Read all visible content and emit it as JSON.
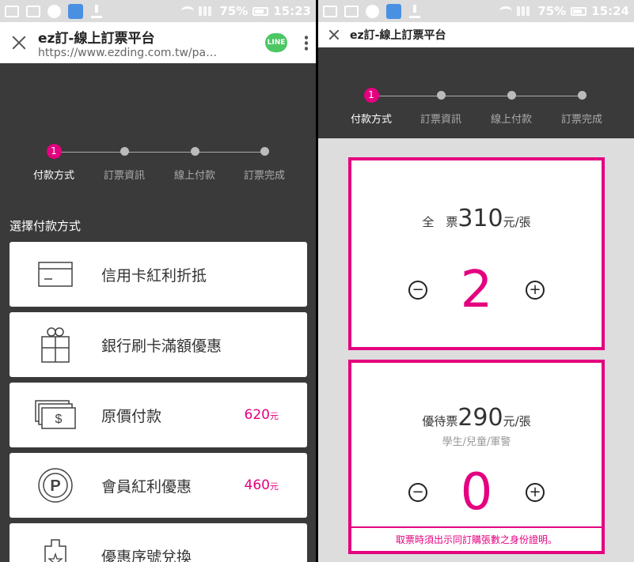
{
  "left": {
    "status": {
      "battery": "75%",
      "time": "15:23"
    },
    "toolbar": {
      "title": "ez訂-線上訂票平台",
      "url": "https://www.ezding.com.tw/pa…",
      "line_label": "LINE"
    },
    "steps": [
      {
        "num": "1",
        "label": "付款方式"
      },
      {
        "label": "訂票資訊"
      },
      {
        "label": "線上付款"
      },
      {
        "label": "訂票完成"
      }
    ],
    "section_label": "選擇付款方式",
    "options": [
      {
        "label": "信用卡紅利折抵",
        "icon": "credit-card-icon"
      },
      {
        "label": "銀行刷卡滿額優惠",
        "icon": "gift-icon"
      },
      {
        "label": "原價付款",
        "icon": "cash-icon",
        "price": "620",
        "unit": "元"
      },
      {
        "label": "會員紅利優惠",
        "icon": "parking-coin-icon",
        "price": "460",
        "unit": "元"
      },
      {
        "label": "優惠序號兌換",
        "icon": "coupon-icon"
      }
    ]
  },
  "right": {
    "status": {
      "battery": "75%",
      "time": "15:24"
    },
    "toolbar": {
      "title": "ez訂-線上訂票平台"
    },
    "steps": [
      {
        "num": "1",
        "label": "付款方式"
      },
      {
        "label": "訂票資訊"
      },
      {
        "label": "線上付款"
      },
      {
        "label": "訂票完成"
      }
    ],
    "tickets": [
      {
        "name": "全　票",
        "price": "310",
        "unit": "元/張",
        "count": 2,
        "minus": "−",
        "plus": "+"
      },
      {
        "name": "優待票",
        "price": "290",
        "unit": "元/張",
        "sub": "學生/兒童/軍警",
        "count": 0,
        "minus": "−",
        "plus": "+",
        "note": "取票時須出示同訂購張數之身份證明。"
      }
    ]
  },
  "colors": {
    "accent": "#e4007f",
    "dark_bg": "#3a3a3a",
    "gray_bg": "#dddddd"
  }
}
